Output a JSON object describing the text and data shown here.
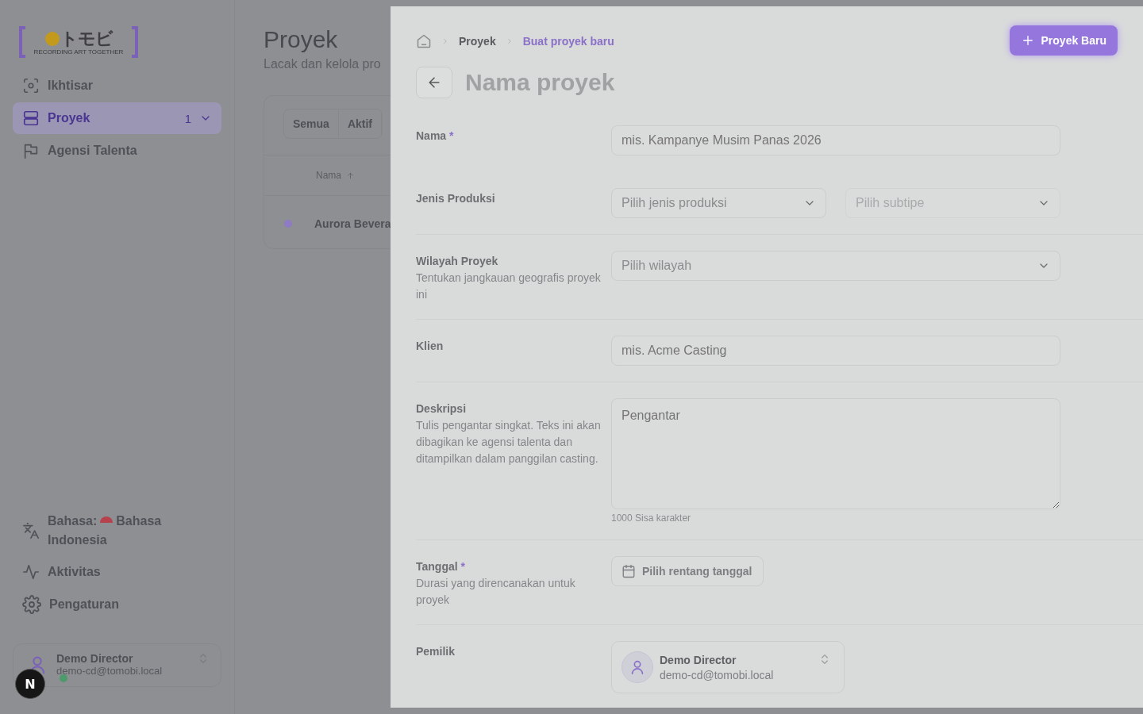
{
  "sidebar": {
    "logo": {
      "wordmark": "トモビ",
      "tagline": "RECORDING ART TOGETHER"
    },
    "nav": [
      {
        "label": "Ikhtisar",
        "selected": false
      },
      {
        "label": "Proyek",
        "selected": true,
        "count": "1"
      },
      {
        "label": "Agensi Talenta",
        "selected": false
      }
    ],
    "language": {
      "label": "Bahasa:",
      "value": "Bahasa Indonesia"
    },
    "footer_nav": [
      {
        "label": "Aktivitas"
      },
      {
        "label": "Pengaturan"
      }
    ],
    "user": {
      "name": "Demo Director",
      "email": "demo-cd@tomobi.local"
    }
  },
  "page": {
    "title": "Proyek",
    "subtitle": "Lacak dan kelola pro",
    "tabs": [
      {
        "label": "Semua"
      },
      {
        "label": "Aktif"
      }
    ],
    "table": {
      "columns": [
        "Nama"
      ],
      "rows": [
        {
          "name": "Aurora Bevera",
          "color": "#8d7bc4"
        }
      ]
    }
  },
  "panel": {
    "breadcrumb": [
      {
        "label": "Proyek",
        "current": false
      },
      {
        "label": "Buat proyek baru",
        "current": true
      }
    ],
    "new_button": "Proyek Baru",
    "title": "Nama proyek",
    "rows": [
      {
        "label": "Nama",
        "required_mark": "*",
        "fields": [
          {
            "kind": "input",
            "placeholder": "mis. Kampanye Musim Panas 2026"
          }
        ]
      },
      {
        "label": "Jenis Produksi",
        "fields": [
          {
            "kind": "select",
            "placeholder": "Pilih jenis produksi",
            "disabled": false
          },
          {
            "kind": "select",
            "placeholder": "Pilih subtipe",
            "disabled": true
          }
        ]
      },
      {
        "label": "Wilayah Proyek",
        "description": "Tentukan jangkauan geografis proyek ini",
        "fields": [
          {
            "kind": "select",
            "placeholder": "Pilih wilayah",
            "disabled": false
          }
        ]
      },
      {
        "label": "Klien",
        "fields": [
          {
            "kind": "input",
            "placeholder": "mis. Acme Casting"
          }
        ]
      },
      {
        "label": "Deskripsi",
        "description": "Tulis pengantar singkat. Teks ini akan dibagikan ke agensi talenta dan ditampilkan dalam panggilan casting.",
        "fields": [
          {
            "kind": "textarea",
            "placeholder": "Pengantar",
            "helper": "1000 Sisa karakter"
          }
        ]
      },
      {
        "label": "Tanggal",
        "required_mark": "*",
        "description": "Durasi yang direncanakan untuk proyek",
        "fields": [
          {
            "kind": "date",
            "label": "Pilih rentang tanggal"
          }
        ]
      },
      {
        "label": "Pemilik",
        "fields": [
          {
            "kind": "person",
            "name": "Demo Director",
            "email": "demo-cd@tomobi.local"
          }
        ]
      }
    ]
  },
  "dev_badge": {
    "label": "N"
  }
}
